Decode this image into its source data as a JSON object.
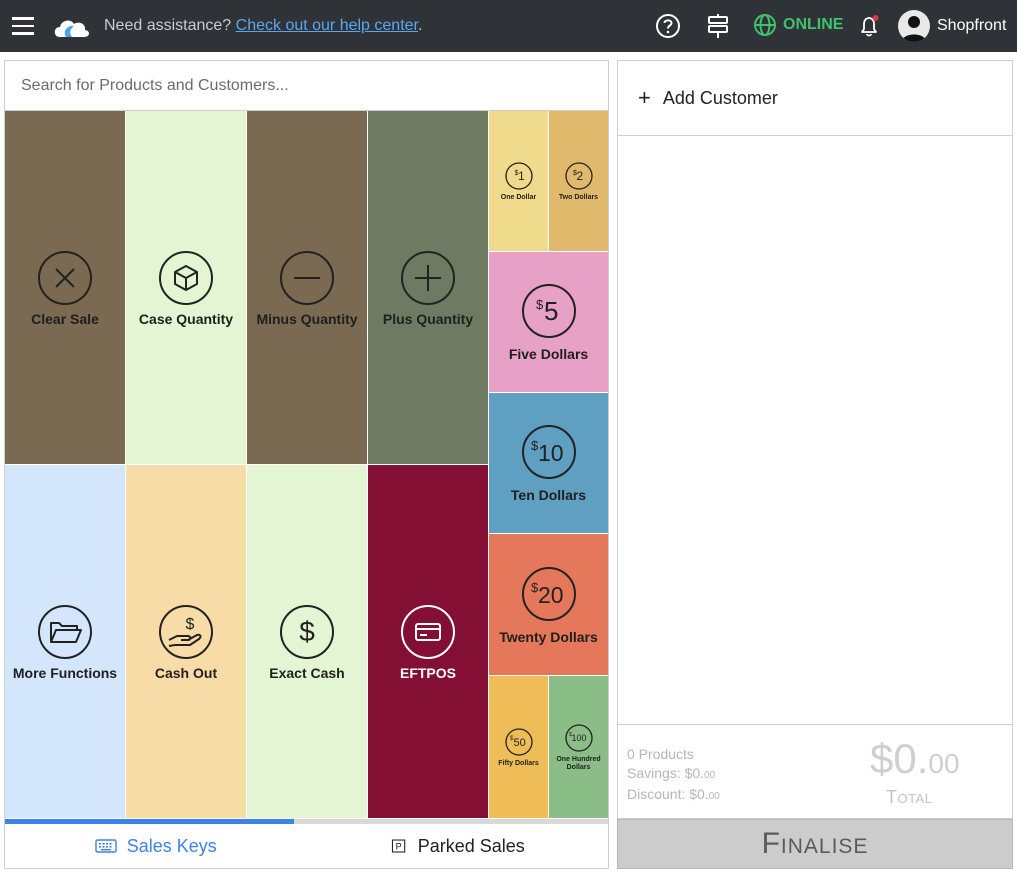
{
  "topbar": {
    "assist_text": "Need assistance? ",
    "assist_link": "Check out our help center",
    "assist_end": ".",
    "status": "ONLINE",
    "user_name": "Shopfront"
  },
  "search": {
    "placeholder": "Search for Products and Customers..."
  },
  "keys": {
    "clear_sale": "Clear Sale",
    "case_quantity": "Case Quantity",
    "minus_quantity": "Minus Quantity",
    "plus_quantity": "Plus Quantity",
    "more_functions": "More Functions",
    "cash_out": "Cash Out",
    "exact_cash": "Exact Cash",
    "eftpos": "EFTPOS",
    "one_dollar": "One Dollar",
    "two_dollars": "Two Dollars",
    "five_dollars": "Five Dollars",
    "ten_dollars": "Ten Dollars",
    "twenty_dollars": "Twenty Dollars",
    "fifty_dollars": "Fifty Dollars",
    "hundred_dollars": "One Hundred Dollars"
  },
  "denominations": {
    "d1": "1",
    "d2": "2",
    "d5": "5",
    "d10": "10",
    "d20": "20",
    "d50": "50",
    "d100": "100"
  },
  "colors": {
    "brown": "#7a6a52",
    "light_green": "#e3f5d3",
    "sage": "#6f7a62",
    "light_blue": "#d4e6fb",
    "peach": "#f8dca8",
    "crimson": "#840f35",
    "yellow": "#f0da8c",
    "mustard": "#e0b96c",
    "pink": "#e7a0c6",
    "steel_blue": "#5f9fc1",
    "coral": "#e5785b",
    "gold": "#efbd58",
    "green": "#8bbd86"
  },
  "tabs": {
    "sales_keys": "Sales Keys",
    "parked_sales": "Parked Sales",
    "page_progress": 0.48
  },
  "cart": {
    "add_customer": "Add Customer",
    "products": "0 Products",
    "savings_label": "Savings: $0.",
    "savings_cents": "00",
    "discount_label": "Discount: $0.",
    "discount_cents": "00",
    "total_dollars": "$0.",
    "total_cents": "00",
    "total_label": "Total",
    "finalise": "Finalise"
  }
}
